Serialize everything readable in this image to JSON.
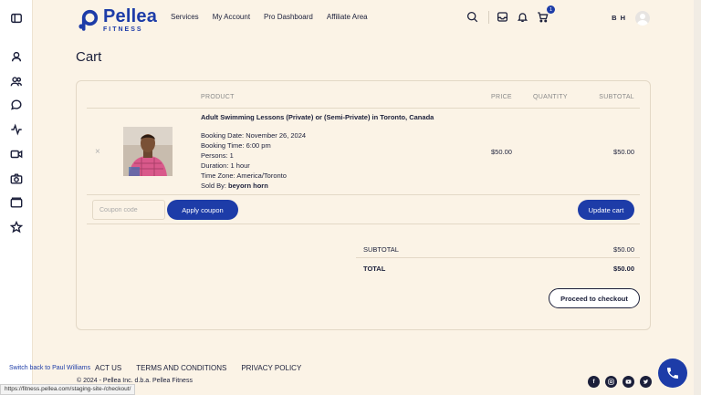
{
  "brand": {
    "name": "Pellea",
    "sub": "FITNESS",
    "color": "#1d3ca8"
  },
  "nav": {
    "items": [
      "Services",
      "My Account",
      "Pro Dashboard",
      "Affiliate Area"
    ]
  },
  "header": {
    "initials": "B H",
    "cart_count": "1"
  },
  "sidebar": {
    "icons": [
      "sidebar-toggle-icon",
      "user-icon",
      "users-icon",
      "chat-icon",
      "activity-icon",
      "video-icon",
      "camera-icon",
      "folder-icon",
      "star-icon"
    ]
  },
  "page": {
    "title": "Cart"
  },
  "table": {
    "headers": {
      "product": "PRODUCT",
      "price": "PRICE",
      "quantity": "QUANTITY",
      "subtotal": "SUBTOTAL"
    }
  },
  "item": {
    "remove": "×",
    "title": "Adult Swimming Lessons (Private) or (Semi-Private) in Toronto, Canada",
    "meta": [
      "Booking Date: November 26, 2024",
      "Booking Time: 6:00 pm",
      "Persons: 1",
      "Duration: 1 hour",
      "Time Zone: America/Toronto"
    ],
    "sold_by_label": "Sold By:",
    "sold_by": "beyorn horn",
    "price": "$50.00",
    "subtotal": "$50.00"
  },
  "coupon": {
    "placeholder": "Coupon code",
    "apply": "Apply coupon",
    "update": "Update cart"
  },
  "totals": {
    "subtotal_label": "SUBTOTAL",
    "subtotal_value": "$50.00",
    "total_label": "TOTAL",
    "total_value": "$50.00",
    "checkout": "Proceed to checkout"
  },
  "footer": {
    "switch": "Switch back to Paul Williams",
    "links": [
      "ACT US",
      "TERMS AND CONDITIONS",
      "PRIVACY POLICY"
    ],
    "copyright": "© 2024 - Pellea Inc. d.b.a. Pellea Fitness",
    "status_url": "https://fitness.pellea.com/staging-site-/checkout/",
    "socials": [
      "facebook-icon",
      "instagram-icon",
      "youtube-icon",
      "twitter-icon"
    ]
  }
}
